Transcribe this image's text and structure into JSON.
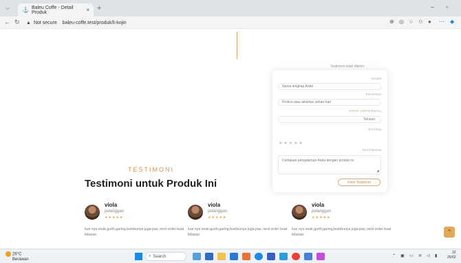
{
  "browser": {
    "tab_title": "Baleu Coffe - Detail Produk",
    "tab_close": "×",
    "new_tab": "+",
    "security_label": "Not secure",
    "url": "baleu-coffe.test/produk/li-kojin"
  },
  "form": {
    "info_text": "Testimoni telah dikirim",
    "name_label": "NAMA",
    "name_placeholder": "Nama lengkap Anda",
    "profession_label": "PROFESI",
    "profession_placeholder": "Profesi atau aktivitas sehari-hari",
    "photo_label": "FOTO (OPSIONAL)",
    "photo_value": "Telusuri",
    "rating_label": "RATING",
    "stars": "★★★★★",
    "testimony_label": "TESTIMONI",
    "testimony_placeholder": "Ceritakan pengalaman Anda dengan produk ini",
    "submit_label": "Kirim Testimoni"
  },
  "section": {
    "kicker": "TESTIMONI",
    "title": "Testimoni untuk Produk Ini"
  },
  "testimonials": [
    {
      "name": "viola",
      "role": "pelanggan",
      "stars": "★★★★★",
      "quote": "kue nya enak,gurih,garing,bumbunya juga pas, next order buat lebaran"
    },
    {
      "name": "viola",
      "role": "pelanggan",
      "stars": "★★★★★",
      "quote": "kue nya enak,gurih,garing,bumbunya juga pas, next order buat lebaran"
    },
    {
      "name": "viola",
      "role": "pelanggan",
      "stars": "★★★★★",
      "quote": "kue nya enak,gurih,garing,bumbunya juga pas, next order buat lebaran"
    }
  ],
  "taskbar": {
    "temp": "26°C",
    "weather": "Berawan",
    "search_label": "Search",
    "time": "22",
    "date": "25/02"
  },
  "colors": {
    "accent": "#d0924f",
    "star": "#e6a23c",
    "scroll_button": "#e4a85a"
  }
}
